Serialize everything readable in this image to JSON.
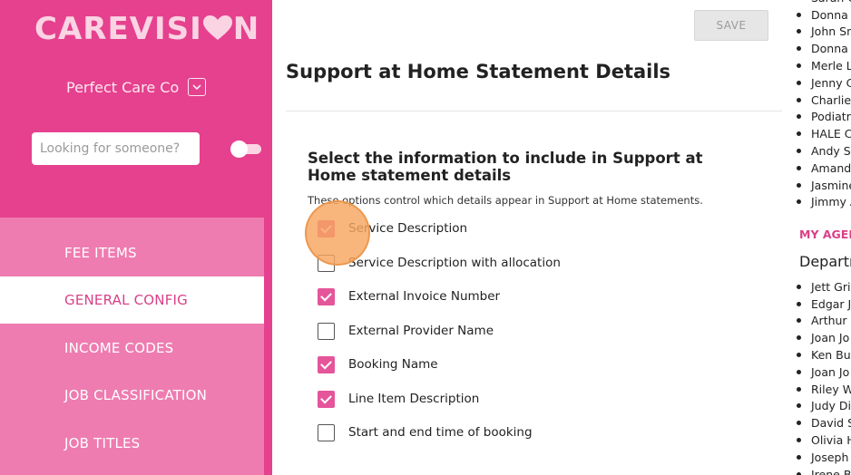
{
  "brand": {
    "logo_prefix": "CAREVISI",
    "logo_suffix": "N",
    "logo_color": "#fbd4e4"
  },
  "org": {
    "name": "Perfect Care Co"
  },
  "search": {
    "placeholder": "Looking for someone?"
  },
  "nav": {
    "items": [
      {
        "label": "FEE ITEMS",
        "active": false
      },
      {
        "label": "GENERAL CONFIG",
        "active": true
      },
      {
        "label": "INCOME CODES",
        "active": false
      },
      {
        "label": "JOB CLASSIFICATION",
        "active": false
      },
      {
        "label": "JOB TITLES",
        "active": false
      }
    ]
  },
  "toolbar": {
    "save_label": "SAVE"
  },
  "page": {
    "title": "Support at Home Statement Details",
    "section_title": "Select the information to include in Support at Home statement details",
    "section_desc": "These options control which details appear in Support at Home statements."
  },
  "options": [
    {
      "label": "Service Description",
      "checked": true
    },
    {
      "label": "Service Description with allocation",
      "checked": false
    },
    {
      "label": "External Invoice Number",
      "checked": true
    },
    {
      "label": "External Provider Name",
      "checked": false
    },
    {
      "label": "Booking Name",
      "checked": true
    },
    {
      "label": "Line Item Description",
      "checked": true
    },
    {
      "label": "Start and end time of booking",
      "checked": false
    }
  ],
  "right_panel": {
    "list_top": [
      "Sarah C",
      "Donna",
      "John Sn",
      "Donna",
      "Merle L",
      "Jenny C",
      "Charlie",
      "Podiatr",
      "HALE C",
      "Andy S",
      "Amand",
      "Jasmine",
      "Jimmy A"
    ],
    "heading": "MY AGED",
    "subheading": "Departr",
    "list_bottom": [
      "Jett Gri",
      "Edgar J",
      "Arthur",
      "Joan Jo",
      "Ken Bu",
      "Joan Jo",
      "Riley W",
      "Judy Di",
      "David S",
      "Olivia H",
      "Joseph",
      "Irene B"
    ]
  },
  "colors": {
    "brand_pink": "#e5418e",
    "nav_pink": "#ee7cb0",
    "checkbox_pink": "#e5559a",
    "heading_pink": "#d94088"
  }
}
